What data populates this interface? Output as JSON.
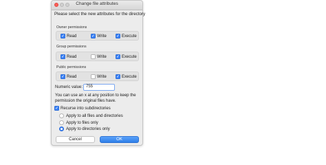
{
  "window": {
    "title": "Change file attributes"
  },
  "heading": "Please select the new attributes for the directory",
  "groups": {
    "owner": {
      "label": "Owner permissions",
      "read": "Read",
      "write": "Write",
      "execute": "Execute"
    },
    "group": {
      "label": "Group permissions",
      "read": "Read",
      "write": "Write",
      "execute": "Execute"
    },
    "public": {
      "label": "Public permissions",
      "read": "Read",
      "write": "Write",
      "execute": "Execute"
    }
  },
  "checked": {
    "owner": {
      "read": true,
      "write": true,
      "execute": true
    },
    "group": {
      "read": true,
      "write": false,
      "execute": true
    },
    "public": {
      "read": true,
      "write": false,
      "execute": true
    }
  },
  "numeric": {
    "label": "Numeric value:",
    "value": "755"
  },
  "help": {
    "line1": "You can use an x at any position to keep the",
    "line2": "permission the original files have."
  },
  "recurse": {
    "label": "Recurse into subdirectories",
    "checked": true
  },
  "apply": {
    "all": "Apply to all files and directories",
    "files": "Apply to files only",
    "dirs": "Apply to directories only",
    "selected": "dirs"
  },
  "buttons": {
    "cancel": "Cancel",
    "ok": "OK"
  },
  "colors": {
    "accent": "#3b82f6",
    "dialog_bg": "#ececec"
  }
}
